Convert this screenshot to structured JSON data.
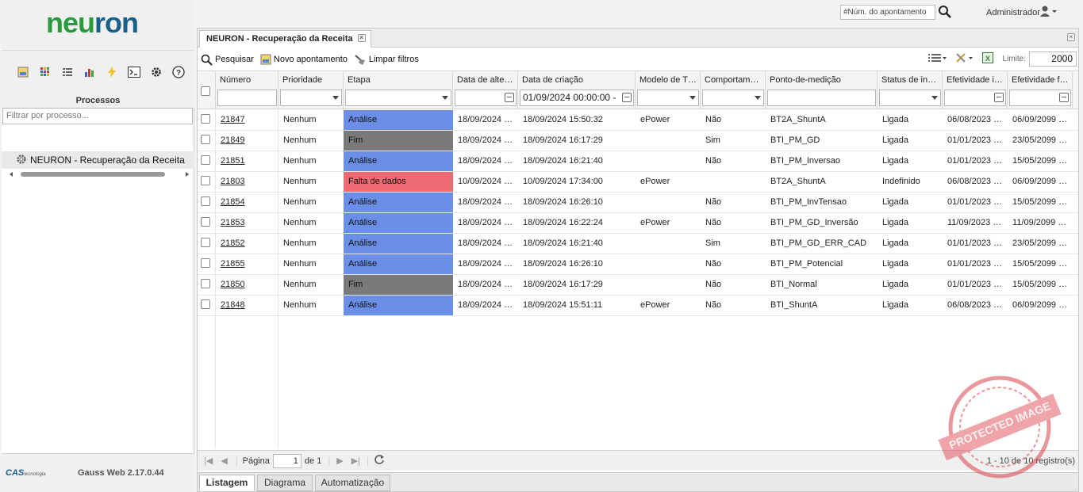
{
  "app": {
    "logo_text_1": "neu",
    "logo_text_2": "ron",
    "version": "Gauss Web 2.17.0.44",
    "company": "CAS",
    "company_sub": "tecnologia"
  },
  "topbar": {
    "search_placeholder": "#Núm. do apontamento",
    "user": "Administrador"
  },
  "sidebar": {
    "section_title": "Processos",
    "filter_placeholder": "Filtrar por processo...",
    "process_item": "NEURON - Recuperação da Receita",
    "icons": [
      "image-icon",
      "grid-color-icon",
      "list-icon",
      "bar-chart-icon",
      "lightning-icon",
      "terminal-icon",
      "gear-icon",
      "help-icon"
    ]
  },
  "main": {
    "tab_title": "NEURON - Recuperação da Receita",
    "toolbar": {
      "search": "Pesquisar",
      "new": "Novo apontamento",
      "clear": "Limpar filtros",
      "limit_label": "Limite:",
      "limit_value": "2000"
    },
    "columns": [
      "Número",
      "Prioridade",
      "Etapa",
      "Data de alte…",
      "Data de criação",
      "Modelo de T…",
      "Comportam…",
      "Ponto-de-medição",
      "Status de in…",
      "Efetividade i…",
      "Efetividade f…"
    ],
    "filters": {
      "created": "01/09/2024 00:00:00 -"
    },
    "rows": [
      {
        "num": "21847",
        "prio": "Nenhum",
        "etapa": "Análise",
        "kind": "analise",
        "alt": "18/09/2024 …",
        "cri": "18/09/2024 15:50:32",
        "mod": "ePower",
        "comp": "Não",
        "ponto": "BT2A_ShuntA",
        "status": "Ligada",
        "ef_i": "06/08/2023 …",
        "ef_f": "06/09/2099 …"
      },
      {
        "num": "21849",
        "prio": "Nenhum",
        "etapa": "Fim",
        "kind": "fim",
        "alt": "18/09/2024 …",
        "cri": "18/09/2024 16:17:29",
        "mod": "",
        "comp": "Sim",
        "ponto": "BTI_PM_GD",
        "status": "Ligada",
        "ef_i": "01/01/2023 …",
        "ef_f": "23/05/2099 …"
      },
      {
        "num": "21851",
        "prio": "Nenhum",
        "etapa": "Análise",
        "kind": "analise",
        "alt": "18/09/2024 …",
        "cri": "18/09/2024 16:21:40",
        "mod": "",
        "comp": "Não",
        "ponto": "BTI_PM_Inversao",
        "status": "Ligada",
        "ef_i": "01/01/2023 …",
        "ef_f": "15/05/2099 …"
      },
      {
        "num": "21803",
        "prio": "Nenhum",
        "etapa": "Falta de dados",
        "kind": "falta",
        "alt": "10/09/2024 …",
        "cri": "10/09/2024 17:34:00",
        "mod": "ePower",
        "comp": "",
        "ponto": "BT2A_ShuntA",
        "status": "Indefinido",
        "ef_i": "06/08/2023 …",
        "ef_f": "06/09/2099 …"
      },
      {
        "num": "21854",
        "prio": "Nenhum",
        "etapa": "Análise",
        "kind": "analise",
        "alt": "18/09/2024 …",
        "cri": "18/09/2024 16:26:10",
        "mod": "",
        "comp": "Não",
        "ponto": "BTI_PM_InvTensao",
        "status": "Ligada",
        "ef_i": "01/01/2023 …",
        "ef_f": "15/05/2099 …"
      },
      {
        "num": "21853",
        "prio": "Nenhum",
        "etapa": "Análise",
        "kind": "analise",
        "alt": "18/09/2024 …",
        "cri": "18/09/2024 16:22:24",
        "mod": "ePower",
        "comp": "Não",
        "ponto": "BTI_PM_GD_Inversão",
        "status": "Ligada",
        "ef_i": "11/09/2023 …",
        "ef_f": "11/09/2099 …"
      },
      {
        "num": "21852",
        "prio": "Nenhum",
        "etapa": "Análise",
        "kind": "analise",
        "alt": "18/09/2024 …",
        "cri": "18/09/2024 16:21:40",
        "mod": "",
        "comp": "Sim",
        "ponto": "BTI_PM_GD_ERR_CAD",
        "status": "Ligada",
        "ef_i": "01/01/2023 …",
        "ef_f": "23/05/2099 …"
      },
      {
        "num": "21855",
        "prio": "Nenhum",
        "etapa": "Análise",
        "kind": "analise",
        "alt": "18/09/2024 …",
        "cri": "18/09/2024 16:26:10",
        "mod": "",
        "comp": "Não",
        "ponto": "BTI_PM_Potencial",
        "status": "Ligada",
        "ef_i": "01/01/2023 …",
        "ef_f": "15/05/2099 …"
      },
      {
        "num": "21850",
        "prio": "Nenhum",
        "etapa": "Fim",
        "kind": "fim",
        "alt": "18/09/2024 …",
        "cri": "18/09/2024 16:17:29",
        "mod": "",
        "comp": "Não",
        "ponto": "BTI_Normal",
        "status": "Ligada",
        "ef_i": "01/01/2023 …",
        "ef_f": "15/05/2099 …"
      },
      {
        "num": "21848",
        "prio": "Nenhum",
        "etapa": "Análise",
        "kind": "analise",
        "alt": "18/09/2024 …",
        "cri": "18/09/2024 15:51:11",
        "mod": "ePower",
        "comp": "Não",
        "ponto": "BTI_ShuntA",
        "status": "Ligada",
        "ef_i": "06/08/2023 …",
        "ef_f": "06/09/2099 …"
      }
    ],
    "pager": {
      "page_label": "Página",
      "page_value": "1",
      "of_label": "de 1",
      "records": "1 - 10 de 10 registro(s)"
    },
    "bottom_tabs": [
      "Listagem",
      "Diagrama",
      "Automatização"
    ]
  },
  "watermark": "PROTECTED IMAGE",
  "colors": {
    "analise": "#6b8fe6",
    "fim": "#7a7a7a",
    "falta": "#ee6b73"
  }
}
